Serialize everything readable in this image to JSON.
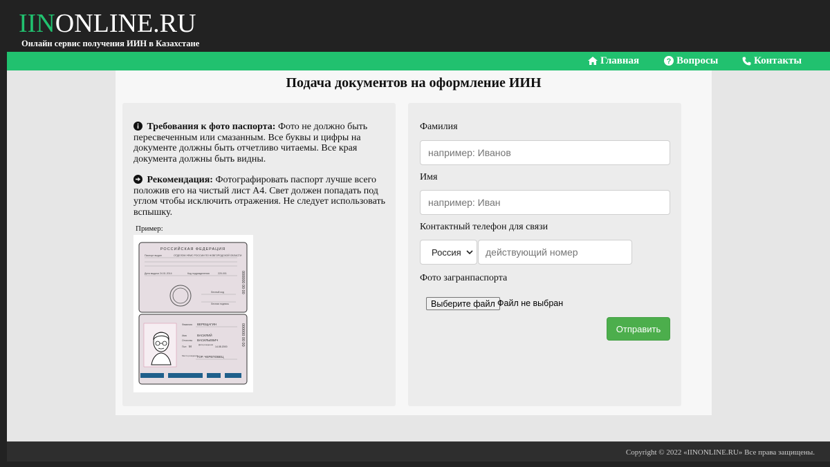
{
  "brand": {
    "logo_accent": "IIN",
    "logo_rest": "ONLINE.RU",
    "tagline": "Онлайн сервис получения ИИН в Казахстане",
    "accent_color": "#21c16f"
  },
  "nav": {
    "items": [
      {
        "label": "Главная",
        "icon": "home-icon"
      },
      {
        "label": "Вопросы",
        "icon": "question-circle-icon"
      },
      {
        "label": "Контакты",
        "icon": "phone-icon"
      }
    ]
  },
  "page": {
    "title": "Подача документов на оформление ИИН"
  },
  "info": {
    "requirements_title": "Требования к фото паспорта:",
    "requirements_text": " Фото не должно быть пересвеченным или смазанным. Все буквы и цифры на документе должны быть отчетливо читаемы. Все края документа должны быть видны.",
    "recommendation_title": "Рекомендация:",
    "recommendation_text": " Фотографировать паспорт лучше всего положив его на чистый лист А4. Свет должен попадать под углом чтобы исключить отражения. Не следует использовать вспышку.",
    "example_label": "Пример:"
  },
  "passport_sample": {
    "header": "РОССИЙСКАЯ ФЕДЕРАЦИЯ",
    "issued_by_label": "Паспорт выдан",
    "issued_by_value": "ОТДЕЛОМ УФМС РОССИИ ПО НОВГОРОДСКОЙ ОБЛАСТИ",
    "issue_date_label": "Дата выдачи",
    "issue_date_value": "24.01.2014",
    "dept_code_label": "Код подразделения",
    "dept_code_value": "220-001",
    "personal_code_label": "Личный код",
    "signature_label": "Личная подпись",
    "serial": "000000 00 00",
    "surname_label": "Фамилия",
    "surname_value": "ВЕРЕЩАГИН",
    "name_label": "Имя",
    "name_value": "ВАСИЛИЙ",
    "patronymic_label": "Отчество",
    "patronymic_value": "ВАСИЛЬЕВИЧ",
    "sex_label": "Пол",
    "sex_value": "М",
    "birthdate_label": "Дата рождения",
    "birthdate_value": "14.08.2000",
    "birthplace_label": "Место рождения",
    "birthplace_value": "ГОР. ЧЕРЕПОВЕЦ"
  },
  "form": {
    "surname_label": "Фамилия",
    "surname_placeholder": "например: Иванов",
    "name_label": "Имя",
    "name_placeholder": "например: Иван",
    "phone_label": "Контактный телефон для связи",
    "country_selected": "Россия",
    "phone_placeholder": "действующий номер",
    "photo_label": "Фото загранпаспорта",
    "file_button": "Выберите файл",
    "file_status": "Файл не выбран",
    "submit_label": "Отправить",
    "submit_color": "#4cae4c"
  },
  "footer": {
    "copyright": "Copyright © 2022 «IINONLINE.RU» Все права защищены."
  }
}
